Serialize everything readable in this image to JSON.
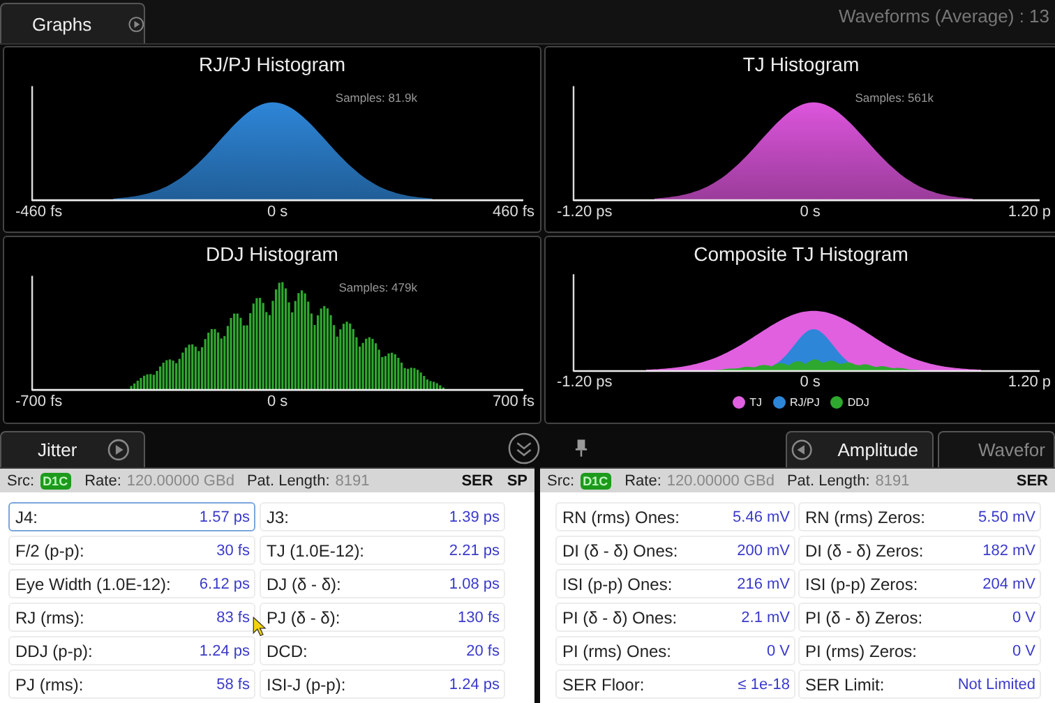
{
  "top_tab": {
    "label": "Graphs"
  },
  "status": "Waveforms (Average) : 13",
  "graphs": [
    {
      "title": "RJ/PJ Histogram",
      "samples": "Samples: 81.9k",
      "kind": "gaussian",
      "color": "#2e86d8",
      "ticks": [
        "-460 fs",
        "0 s",
        "460 fs"
      ]
    },
    {
      "title": "TJ Histogram",
      "samples": "Samples: 561k",
      "kind": "gaussian",
      "color": "#dd55dd",
      "ticks": [
        "-1.20 ps",
        "0 s",
        "1.20 p"
      ]
    },
    {
      "title": "DDJ Histogram",
      "samples": "Samples: 479k",
      "kind": "bars",
      "color": "#2fa82f",
      "ticks": [
        "-700 fs",
        "0 s",
        "700 fs"
      ]
    },
    {
      "title": "Composite TJ Histogram",
      "kind": "composite",
      "ticks": [
        "-1.20 ps",
        "0 s",
        "1.20 p"
      ],
      "legend": [
        {
          "label": "TJ",
          "color": "#e060e0"
        },
        {
          "label": "RJ/PJ",
          "color": "#2e86d8"
        },
        {
          "label": "DDJ",
          "color": "#2fa82f"
        }
      ]
    }
  ],
  "panels": [
    {
      "tabs": [
        {
          "label": "Jitter",
          "selected": true
        }
      ],
      "src_label": "Src:",
      "src": "D1C",
      "rate_label": "Rate:",
      "rate": "120.00000 GBd",
      "pat_label": "Pat. Length:",
      "pat": "8191",
      "flags": [
        "SER",
        "SP"
      ],
      "cells": [
        {
          "label": "J4:",
          "value": "1.57 ps",
          "selected": true
        },
        {
          "label": "J3:",
          "value": "1.39 ps",
          "selected": false
        },
        {
          "label": "F/2 (p-p):",
          "value": "30 fs",
          "selected": false
        },
        {
          "label": "TJ (1.0E-12):",
          "value": "2.21 ps",
          "selected": false
        },
        {
          "label": "Eye Width (1.0E-12):",
          "value": "6.12 ps",
          "selected": false
        },
        {
          "label": "DJ (δ - δ):",
          "value": "1.08 ps",
          "selected": false
        },
        {
          "label": "RJ (rms):",
          "value": "83 fs",
          "selected": false
        },
        {
          "label": "PJ (δ - δ):",
          "value": "130 fs",
          "selected": false
        },
        {
          "label": "DDJ (p-p):",
          "value": "1.24 ps",
          "selected": false
        },
        {
          "label": "DCD:",
          "value": "20 fs",
          "selected": false
        },
        {
          "label": "PJ (rms):",
          "value": "58 fs",
          "selected": false
        },
        {
          "label": "ISI-J (p-p):",
          "value": "1.24 ps",
          "selected": false
        }
      ]
    },
    {
      "tabs": [
        {
          "label": "Amplitude",
          "selected": true
        },
        {
          "label": "Wavefor",
          "selected": false
        }
      ],
      "src_label": "Src:",
      "src": "D1C",
      "rate_label": "Rate:",
      "rate": "120.00000 GBd",
      "pat_label": "Pat. Length:",
      "pat": "8191",
      "flags": [
        "SER"
      ],
      "cells": [
        {
          "label": "RN (rms) Ones:",
          "value": "5.46 mV",
          "selected": false
        },
        {
          "label": "RN (rms) Zeros:",
          "value": "5.50 mV",
          "selected": false
        },
        {
          "label": "DI (δ - δ) Ones:",
          "value": "200 mV",
          "selected": false
        },
        {
          "label": "DI (δ - δ) Zeros:",
          "value": "182 mV",
          "selected": false
        },
        {
          "label": "ISI (p-p) Ones:",
          "value": "216 mV",
          "selected": false
        },
        {
          "label": "ISI (p-p) Zeros:",
          "value": "204 mV",
          "selected": false
        },
        {
          "label": "PI (δ - δ) Ones:",
          "value": "2.1 mV",
          "selected": false
        },
        {
          "label": "PI (δ - δ) Zeros:",
          "value": "0 V",
          "selected": false
        },
        {
          "label": "PI (rms) Ones:",
          "value": "0 V",
          "selected": false
        },
        {
          "label": "PI (rms) Zeros:",
          "value": "0 V",
          "selected": false
        },
        {
          "label": "SER Floor:",
          "value": "≤ 1e-18",
          "selected": false
        },
        {
          "label": "SER Limit:",
          "value": "Not Limited",
          "selected": false
        }
      ]
    }
  ]
}
